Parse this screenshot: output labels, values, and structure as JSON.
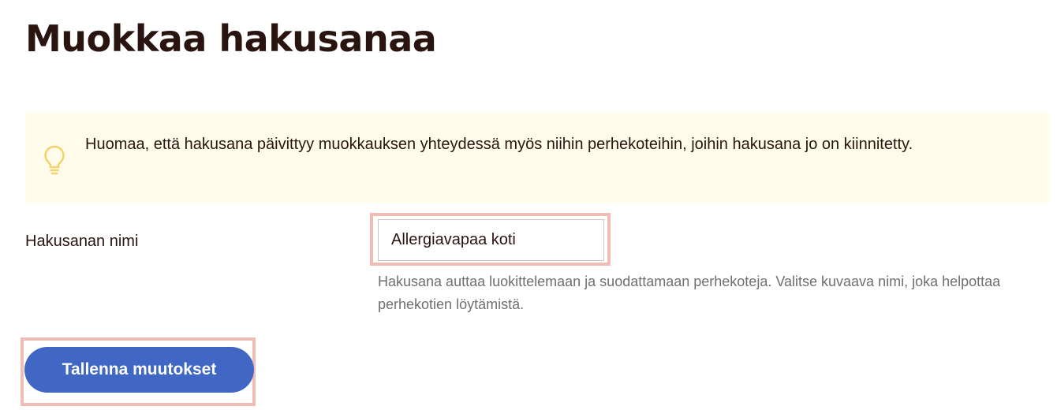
{
  "page": {
    "title": "Muokkaa hakusanaa"
  },
  "notice": {
    "icon": "lightbulb-icon",
    "text": "Huomaa, että hakusana päivittyy muokkauksen yhteydessä myös niihin perhekoteihin, joihin hakusana jo on kiinnitetty."
  },
  "form": {
    "name_label": "Hakusanan nimi",
    "name_value": "Allergiavapaa koti",
    "name_help": "Hakusana auttaa luokittelemaan ja suodattamaan perhekoteja. Valitse kuvaava nimi, joka helpottaa perhekotien löytämistä."
  },
  "actions": {
    "save_label": "Tallenna muutokset"
  },
  "colors": {
    "primary": "#4067c3",
    "notice_bg": "#fffcec",
    "notice_icon": "#f3d36b",
    "highlight": "#efbcb6",
    "text": "#2a140f",
    "muted_text": "#6f6f6f"
  }
}
